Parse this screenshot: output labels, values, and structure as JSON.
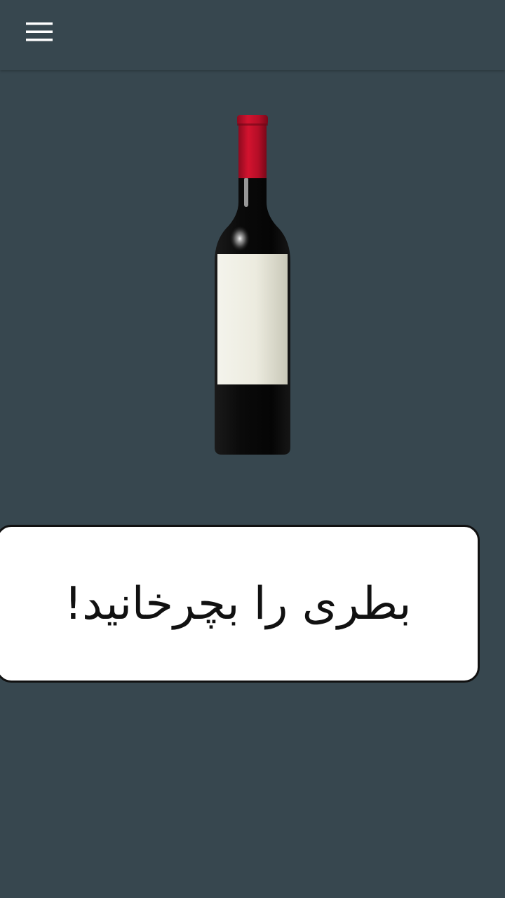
{
  "colors": {
    "background": "#37474F",
    "app_bar": "#37474F",
    "menu_icon": "#FFFFFF",
    "bottle_glass": "#0B0B0B",
    "bottle_cap": "#C8102E",
    "bottle_label": "#EFEFE4",
    "message_box": "#FFFFFF",
    "message_border": "#111111",
    "message_text": "#111111"
  },
  "app_bar": {
    "menu_icon": "hamburger-menu-icon"
  },
  "main": {
    "bottle_icon": "wine-bottle-icon",
    "message": "بطری را بچرخانید!"
  }
}
